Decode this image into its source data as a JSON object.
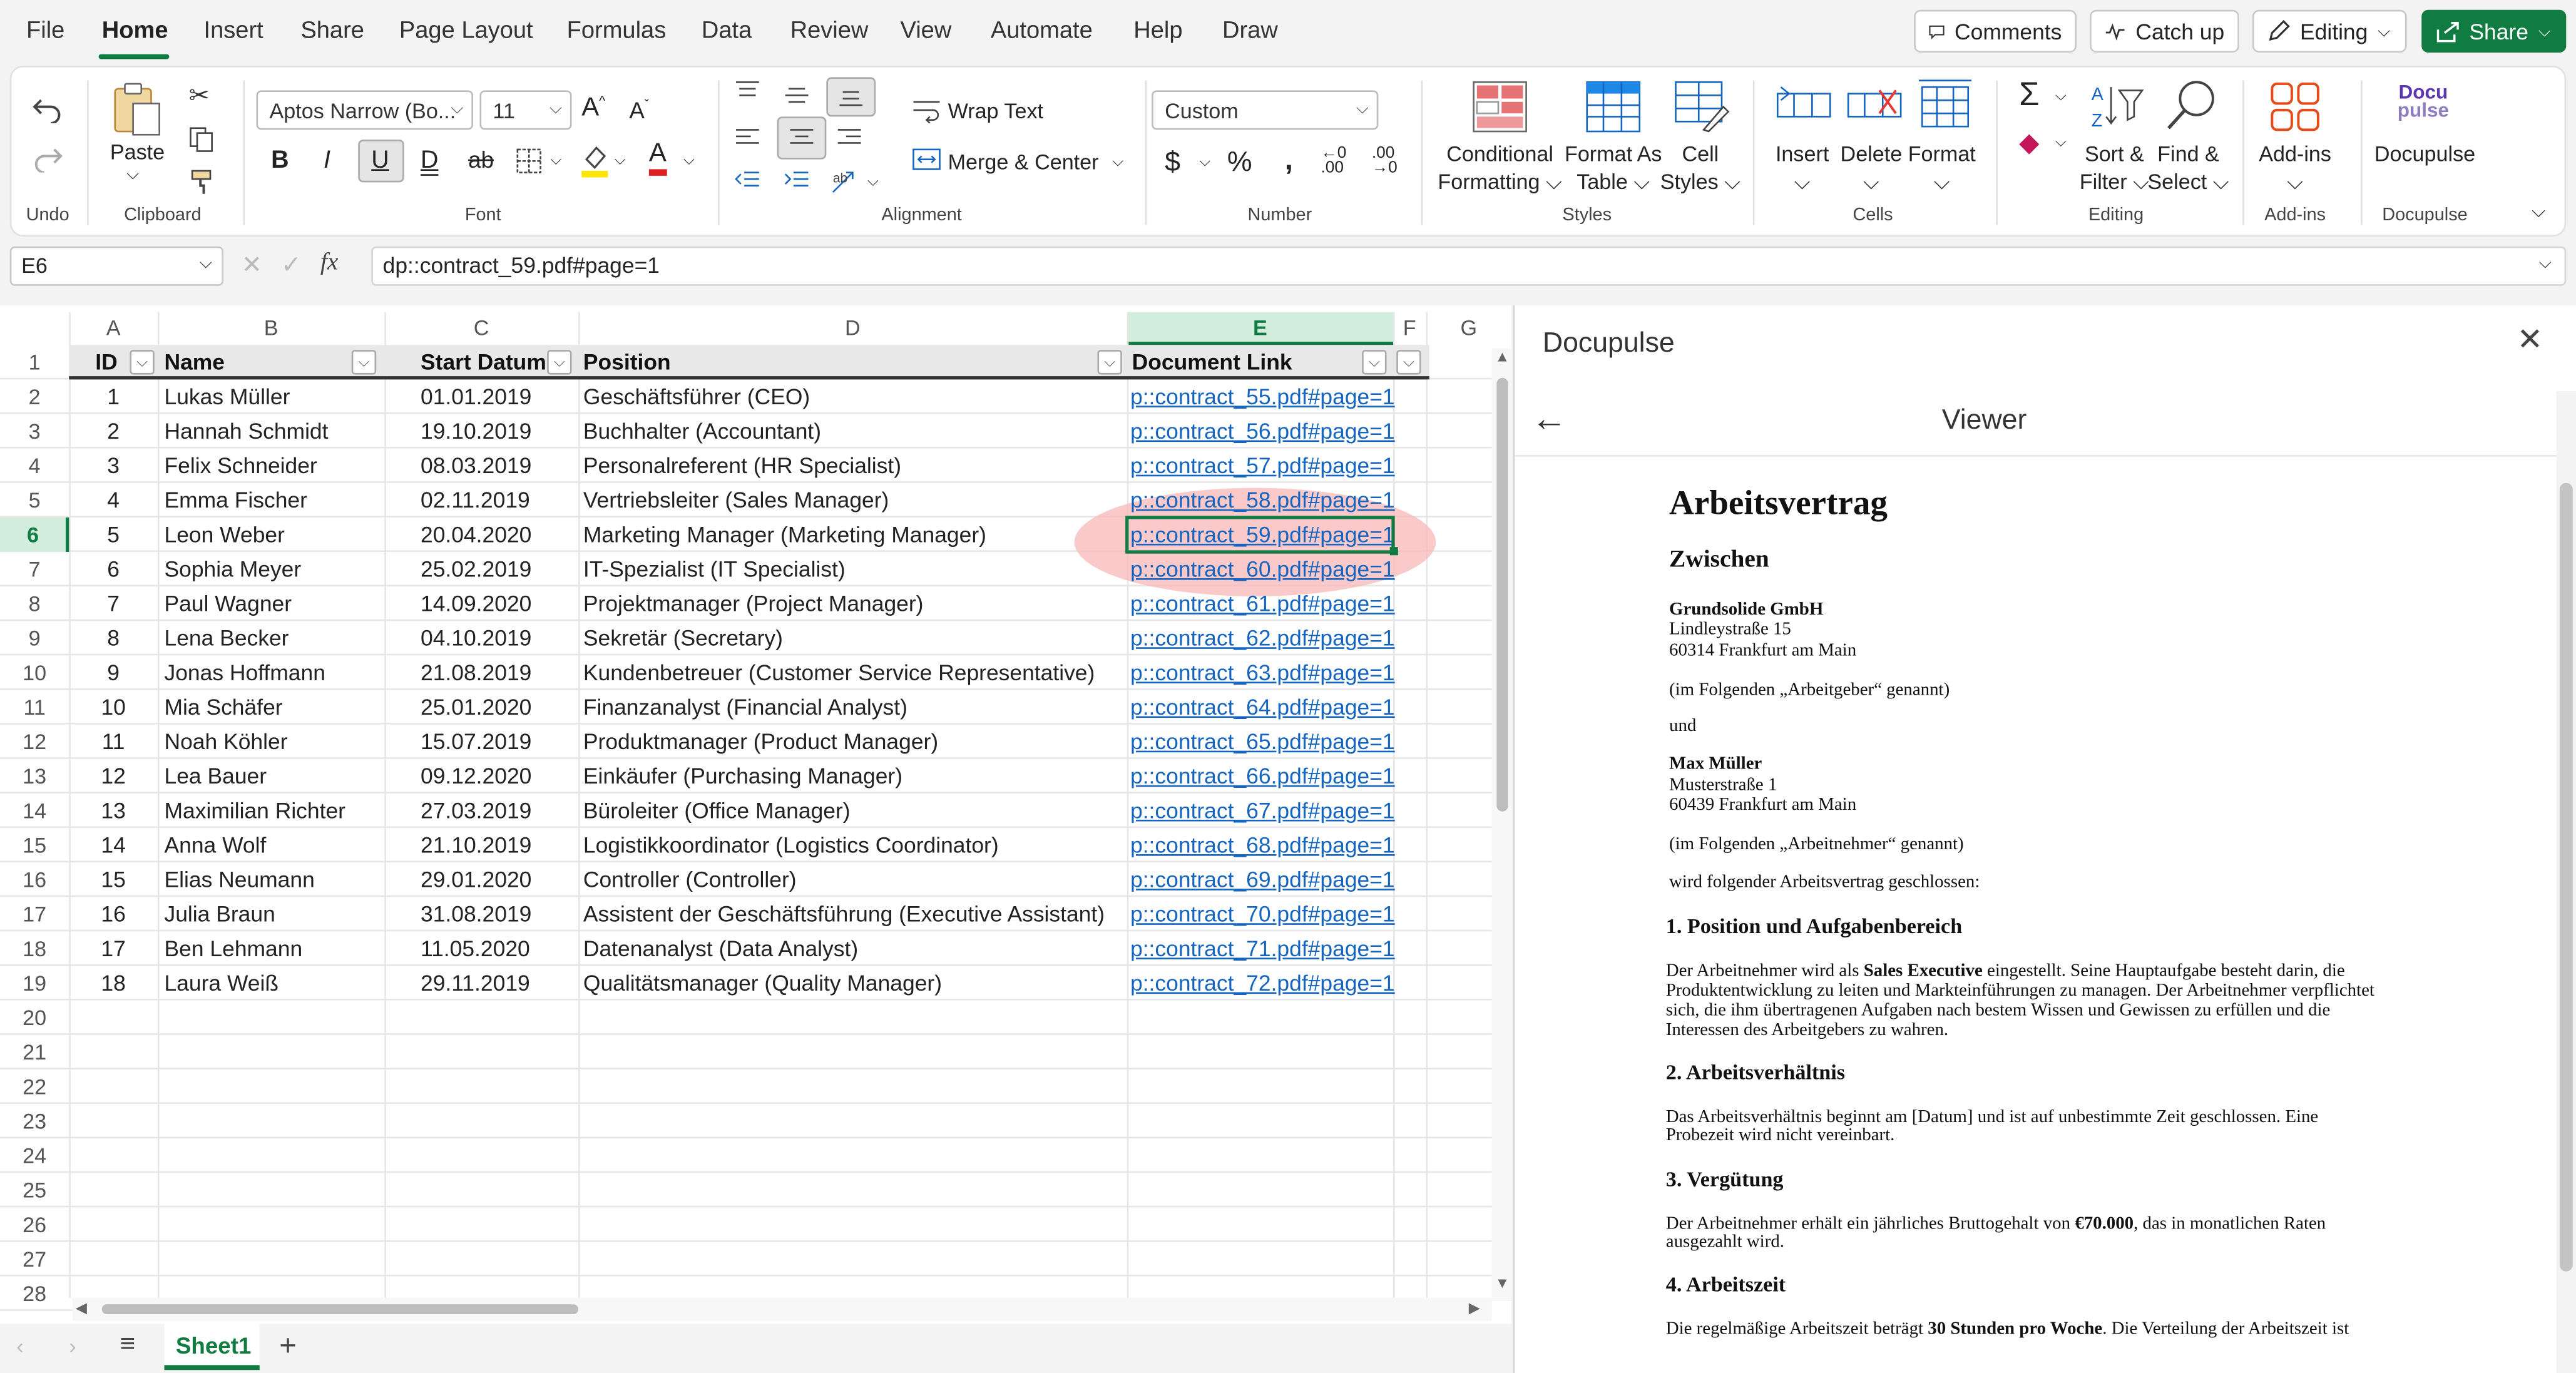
{
  "menu": {
    "items": [
      "File",
      "Home",
      "Insert",
      "Share",
      "Page Layout",
      "Formulas",
      "Data",
      "Review",
      "View",
      "Automate",
      "Help",
      "Draw"
    ],
    "active": "Home",
    "comments": "Comments",
    "catchup": "Catch up",
    "editing": "Editing",
    "share": "Share"
  },
  "ribbon": {
    "undo_group": "Undo",
    "paste": "Paste",
    "clipboard": "Clipboard",
    "font_name": "Aptos Narrow (Bo...",
    "font_size": "11",
    "font_group": "Font",
    "wrap_text": "Wrap Text",
    "merge_center": "Merge & Center",
    "alignment": "Alignment",
    "number_format": "Custom",
    "number": "Number",
    "conditional": "Conditional\nFormatting",
    "conditional_l1": "Conditional",
    "conditional_l2": "Formatting",
    "format_table_l1": "Format As",
    "format_table_l2": "Table",
    "cell_styles_l1": "Cell",
    "cell_styles_l2": "Styles",
    "styles": "Styles",
    "insert": "Insert",
    "delete": "Delete",
    "format": "Format",
    "cells": "Cells",
    "sort_l1": "Sort &",
    "sort_l2": "Filter",
    "find_l1": "Find &",
    "find_l2": "Select",
    "editing": "Editing",
    "addins": "Add-ins",
    "addins_group": "Add-ins",
    "docupulse_logo_l1": "Docu",
    "docupulse_logo_l2": "pulse",
    "docupulse": "Docupulse",
    "docupulse_group": "Docupulse"
  },
  "formula": {
    "cell_ref": "E6",
    "fx": "fx",
    "value": "dp::contract_59.pdf#page=1"
  },
  "grid": {
    "columns": [
      "A",
      "B",
      "C",
      "D",
      "E",
      "F",
      "G"
    ],
    "headers": [
      "ID",
      "Name",
      "Start Datum",
      "Position",
      "Document Link"
    ],
    "rows": [
      [
        "1",
        "Lukas Müller",
        "01.01.2019",
        "Geschäftsführer (CEO)",
        "p::contract_55.pdf#page=1"
      ],
      [
        "2",
        "Hannah Schmidt",
        "19.10.2019",
        "Buchhalter (Accountant)",
        "p::contract_56.pdf#page=1"
      ],
      [
        "3",
        "Felix Schneider",
        "08.03.2019",
        "Personalreferent (HR Specialist)",
        "p::contract_57.pdf#page=1"
      ],
      [
        "4",
        "Emma Fischer",
        "02.11.2019",
        "Vertriebsleiter (Sales Manager)",
        "p::contract_58.pdf#page=1"
      ],
      [
        "5",
        "Leon Weber",
        "20.04.2020",
        "Marketing Manager (Marketing Manager)",
        "p::contract_59.pdf#page=1"
      ],
      [
        "6",
        "Sophia Meyer",
        "25.02.2019",
        "IT-Spezialist (IT Specialist)",
        "p::contract_60.pdf#page=1"
      ],
      [
        "7",
        "Paul Wagner",
        "14.09.2020",
        "Projektmanager (Project Manager)",
        "p::contract_61.pdf#page=1"
      ],
      [
        "8",
        "Lena Becker",
        "04.10.2019",
        "Sekretär (Secretary)",
        "p::contract_62.pdf#page=1"
      ],
      [
        "9",
        "Jonas Hoffmann",
        "21.08.2019",
        "Kundenbetreuer (Customer Service Representative)",
        "p::contract_63.pdf#page=1"
      ],
      [
        "10",
        "Mia Schäfer",
        "25.01.2020",
        "Finanzanalyst (Financial Analyst)",
        "p::contract_64.pdf#page=1"
      ],
      [
        "11",
        "Noah Köhler",
        "15.07.2019",
        "Produktmanager (Product Manager)",
        "p::contract_65.pdf#page=1"
      ],
      [
        "12",
        "Lea Bauer",
        "09.12.2020",
        "Einkäufer (Purchasing Manager)",
        "p::contract_66.pdf#page=1"
      ],
      [
        "13",
        "Maximilian Richter",
        "27.03.2019",
        "Büroleiter (Office Manager)",
        "p::contract_67.pdf#page=1"
      ],
      [
        "14",
        "Anna Wolf",
        "21.10.2019",
        "Logistikkoordinator (Logistics Coordinator)",
        "p::contract_68.pdf#page=1"
      ],
      [
        "15",
        "Elias Neumann",
        "29.01.2020",
        "Controller (Controller)",
        "p::contract_69.pdf#page=1"
      ],
      [
        "16",
        "Julia Braun",
        "31.08.2019",
        "Assistent der Geschäftsführung (Executive Assistant)",
        "p::contract_70.pdf#page=1"
      ],
      [
        "17",
        "Ben Lehmann",
        "11.05.2020",
        "Datenanalyst (Data Analyst)",
        "p::contract_71.pdf#page=1"
      ],
      [
        "18",
        "Laura Weiß",
        "29.11.2019",
        "Qualitätsmanager (Quality Manager)",
        "p::contract_72.pdf#page=1"
      ]
    ],
    "row_numbers": [
      "1",
      "2",
      "3",
      "4",
      "5",
      "6",
      "7",
      "8",
      "9",
      "10",
      "11",
      "12",
      "13",
      "14",
      "15",
      "16",
      "17",
      "18",
      "19",
      "20",
      "21",
      "22",
      "23",
      "24",
      "25",
      "26",
      "27",
      "28"
    ],
    "selected_row": "6"
  },
  "sheet_tab": "Sheet1",
  "panel": {
    "title": "Docupulse",
    "viewer": "Viewer",
    "doc": {
      "title": "Arbeitsvertrag",
      "zwischen": "Zwischen",
      "employer_name": "Grundsolide GmbH",
      "employer_street": "Lindleystraße 15",
      "employer_city": "60314 Frankfurt am Main",
      "employer_alias": "(im Folgenden „Arbeitgeber“ genannt)",
      "und": "und",
      "employee_name": "Max Müller",
      "employee_street": "Musterstraße 1",
      "employee_city": "60439 Frankfurt am Main",
      "employee_alias": "(im Folgenden „Arbeitnehmer“ genannt)",
      "intro": "wird folgender Arbeitsvertrag geschlossen:",
      "s1_title": "1. Position und Aufgabenbereich",
      "s1_l1a": "Der Arbeitnehmer wird als ",
      "s1_l1b": "Sales Executive",
      "s1_l1c": " eingestellt. Seine Hauptaufgabe besteht darin, die",
      "s1_l2": "Produktentwicklung zu leiten und Markteinführungen zu managen. Der Arbeitnehmer verpflichtet",
      "s1_l3": "sich, die ihm übertragenen Aufgaben nach bestem Wissen und Gewissen zu erfüllen und die",
      "s1_l4": "Interessen des Arbeitgebers zu wahren.",
      "s2_title": "2. Arbeitsverhältnis",
      "s2_l1": "Das Arbeitsverhältnis beginnt am [Datum] und ist auf unbestimmte Zeit geschlossen. Eine",
      "s2_l2": "Probezeit wird nicht vereinbart.",
      "s3_title": "3. Vergütung",
      "s3_l1a": "Der Arbeitnehmer erhält ein jährliches Bruttogehalt von ",
      "s3_l1b": "€70.000",
      "s3_l1c": ", das in monatlichen Raten",
      "s3_l2": "ausgezahlt wird.",
      "s4_title": "4. Arbeitszeit",
      "s4_l1a": "Die regelmäßige Arbeitszeit beträgt ",
      "s4_l1b": "30 Stunden pro Woche",
      "s4_l1c": ". Die Verteilung der Arbeitszeit ist"
    }
  },
  "colors": {
    "accent": "#107c41",
    "link": "#1565c0",
    "highlight": "#f8b8b8"
  }
}
